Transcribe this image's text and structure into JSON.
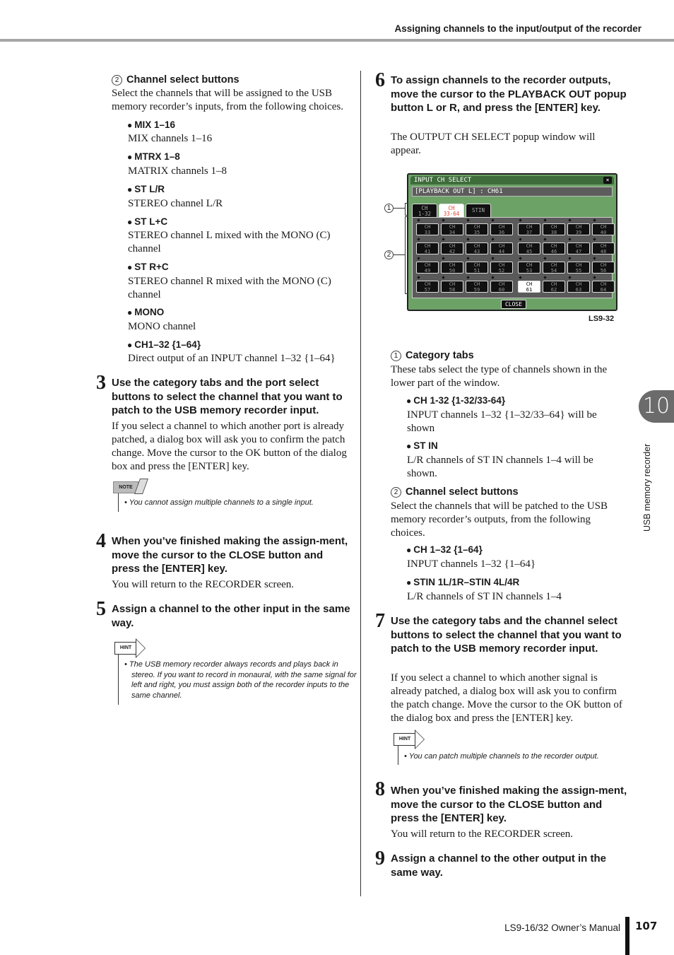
{
  "header": {
    "title": "Assigning channels to the input/output of the recorder"
  },
  "left": {
    "section2": {
      "num": "2",
      "title": "Channel select buttons",
      "text": "Select the channels that will be assigned to the USB memory recorder’s inputs, from the following choices.",
      "choices": [
        {
          "label": "MIX 1–16",
          "desc": "MIX channels 1–16"
        },
        {
          "label": "MTRX 1–8",
          "desc": "MATRIX channels 1–8"
        },
        {
          "label": "ST L/R",
          "desc": "STEREO channel L/R"
        },
        {
          "label": "ST L+C",
          "desc": "STEREO channel L mixed with the MONO (C) channel"
        },
        {
          "label": "ST R+C",
          "desc": "STEREO channel R mixed with the MONO (C) channel"
        },
        {
          "label": "MONO",
          "desc": "MONO channel"
        },
        {
          "label": "CH1–32 {1–64}",
          "desc": "Direct output of an INPUT channel 1–32 {1–64}"
        }
      ]
    },
    "step3": {
      "num": "3",
      "title": "Use the category tabs and the port select buttons to select the channel that you want to patch to the USB memory recorder input.",
      "text": "If you select a channel to which another port is already patched, a dialog box will ask you to confirm the patch change. Move the cursor to the OK button of the dialog box and press the [ENTER] key."
    },
    "note": {
      "label": "NOTE",
      "text": "• You cannot assign multiple channels to a single input."
    },
    "step4": {
      "num": "4",
      "title": "When you’ve finished making the assign-ment, move the cursor to the CLOSE button and press the [ENTER] key.",
      "text": "You will return to the RECORDER screen."
    },
    "step5": {
      "num": "5",
      "title": "Assign a channel to the other input in the same way."
    },
    "hint": {
      "label": "HINT",
      "text": "• The USB memory recorder always records and plays back in stereo. If you want to record in monaural, with the same signal for left and right, you must assign both of the recorder inputs to the same channel."
    }
  },
  "right": {
    "step6": {
      "num": "6",
      "title": "To assign channels to the recorder outputs, move the cursor to the PLAYBACK OUT popup button L or R, and press the [ENTER] key.",
      "text": "The OUTPUT CH SELECT popup window will appear."
    },
    "screen": {
      "title": "INPUT CH SELECT",
      "close_icon": "×",
      "field": "[PLAYBACK OUT L] : CH61",
      "tabs": [
        {
          "line1": "CH",
          "line2": "1-32",
          "active": false
        },
        {
          "line1": "CH",
          "line2": "33-64",
          "active": true
        },
        {
          "line1": "STIN",
          "line2": "",
          "active": false
        }
      ],
      "channels": [
        "33",
        "34",
        "35",
        "36",
        "37",
        "38",
        "39",
        "40",
        "41",
        "42",
        "43",
        "44",
        "45",
        "46",
        "47",
        "48",
        "49",
        "50",
        "51",
        "52",
        "53",
        "54",
        "55",
        "56",
        "57",
        "58",
        "59",
        "60",
        "61",
        "62",
        "63",
        "64"
      ],
      "channel_prefix": "CH",
      "selected_channel": "61",
      "close_button": "CLOSE",
      "callout1": "1",
      "callout2": "2",
      "caption": "LS9-32"
    },
    "sec1": {
      "num": "1",
      "title": "Category tabs",
      "text": "These tabs select the type of channels shown in the lower part of the window.",
      "choices": [
        {
          "label": "CH 1-32 {1-32/33-64}",
          "desc": "INPUT channels 1–32 {1–32/33–64} will be shown"
        },
        {
          "label": "ST IN",
          "desc": "L/R channels of ST IN channels 1–4 will be shown."
        }
      ]
    },
    "sec2": {
      "num": "2",
      "title": "Channel select buttons",
      "text": "Select the channels that will be patched to the USB memory recorder’s outputs, from the following choices.",
      "choices": [
        {
          "label": "CH 1–32 {1–64}",
          "desc": "INPUT channels 1–32 {1–64}"
        },
        {
          "label": "STIN 1L/1R–STIN 4L/4R",
          "desc": "L/R channels of ST IN channels 1–4"
        }
      ]
    },
    "step7": {
      "num": "7",
      "title": "Use the category tabs and the channel select buttons to select the channel that you want to patch to the USB memory recorder input.",
      "text": "If you select a channel to which another signal is already patched, a dialog box will ask you to confirm the patch change. Move the cursor to the OK button of the dialog box and press the [ENTER] key."
    },
    "hint": {
      "label": "HINT",
      "text": "• You can patch multiple channels to the recorder output."
    },
    "step8": {
      "num": "8",
      "title": "When you’ve finished making the assign-ment, move the cursor to the CLOSE button and press the [ENTER] key.",
      "text": "You will return to the RECORDER screen."
    },
    "step9": {
      "num": "9",
      "title": "Assign a channel to the other output in the same way."
    }
  },
  "chapter": {
    "number": "10",
    "name": "USB memory recorder"
  },
  "footer": {
    "manual": "LS9-16/32  Owner’s Manual",
    "page": "107"
  }
}
